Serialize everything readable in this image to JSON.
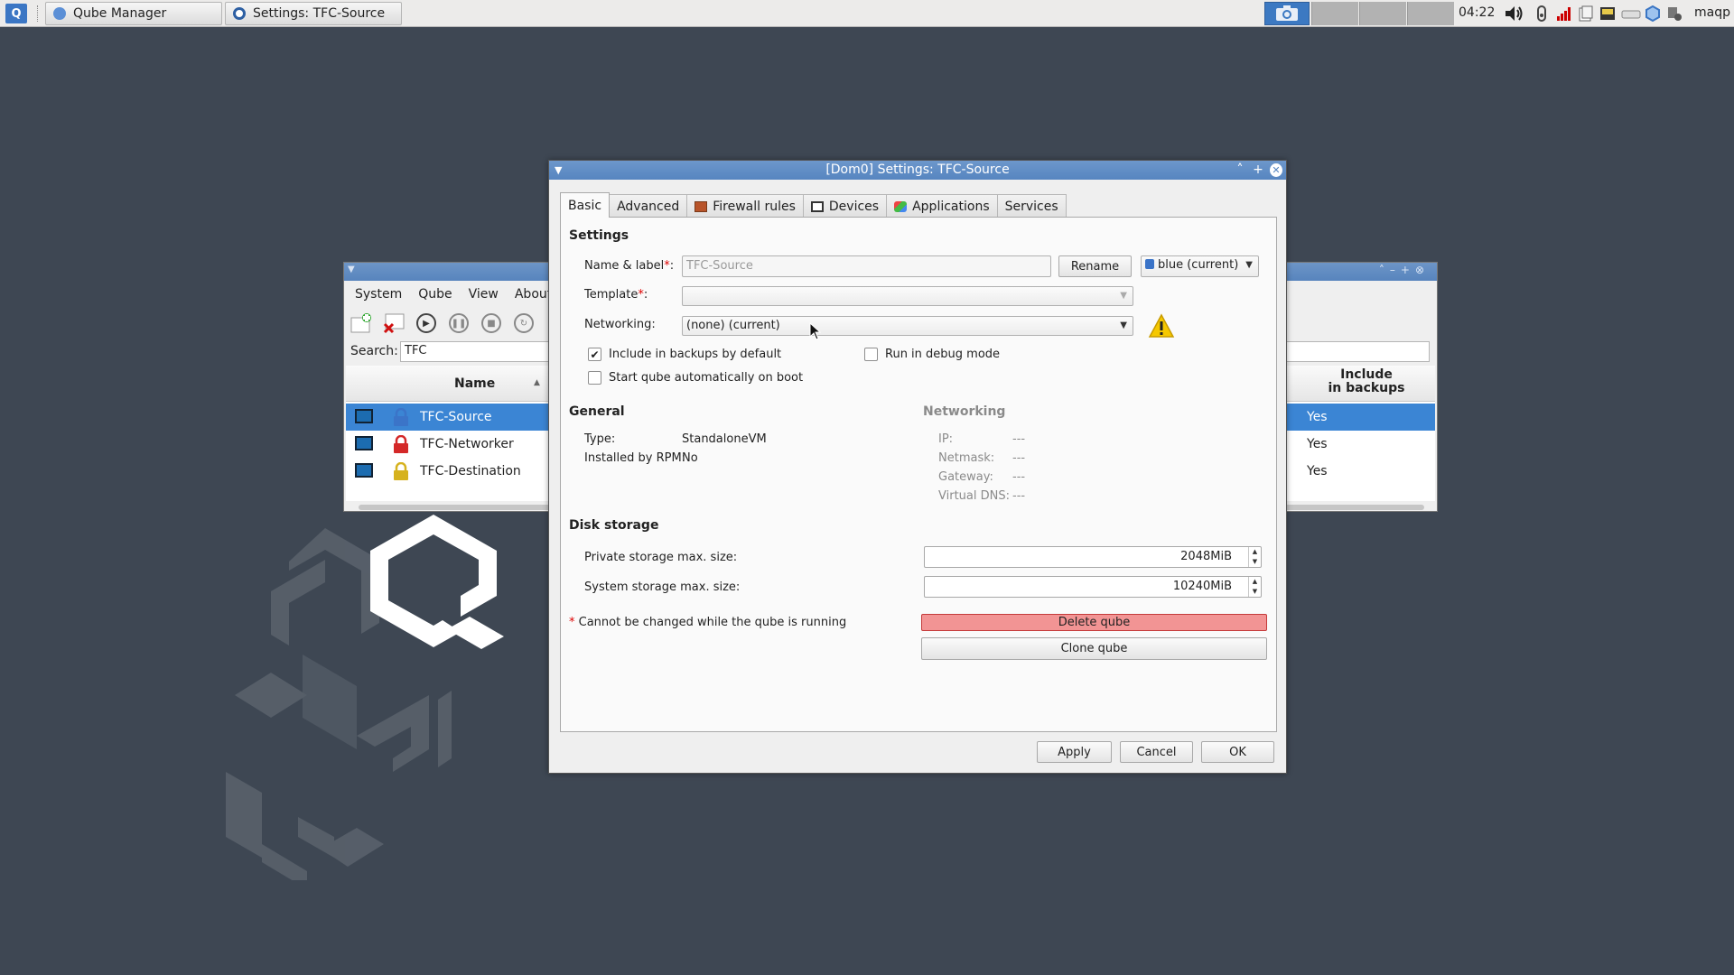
{
  "taskbar": {
    "tasks": [
      {
        "label": "Qube Manager",
        "icon": "qubes-icon"
      },
      {
        "label": "Settings: TFC-Source",
        "icon": "settings-gear-icon"
      }
    ],
    "clock": "04:22",
    "user": "maqp",
    "tray_icons": [
      "screenshot-icon",
      "volume-icon",
      "power-icon",
      "network-signal-icon",
      "clipboard-icon",
      "devices-icon",
      "drive-icon",
      "qubes-domains-icon",
      "updates-icon"
    ]
  },
  "qube_manager": {
    "menus": [
      "System",
      "Qube",
      "View",
      "About"
    ],
    "search_label": "Search:",
    "search_value": "TFC",
    "columns": {
      "name": "Name",
      "backups": "Include\nin backups"
    },
    "rows": [
      {
        "name": "TFC-Source",
        "backups": "Yes",
        "label_color": "#3b74c8",
        "selected": true
      },
      {
        "name": "TFC-Networker",
        "backups": "Yes",
        "label_color": "#d42828",
        "selected": false
      },
      {
        "name": "TFC-Destination",
        "backups": "Yes",
        "label_color": "#d6b21e",
        "selected": false
      }
    ]
  },
  "dialog": {
    "title": "[Dom0] Settings: TFC-Source",
    "tabs": [
      "Basic",
      "Advanced",
      "Firewall rules",
      "Devices",
      "Applications",
      "Services"
    ],
    "active_tab": "Basic",
    "settings": {
      "heading": "Settings",
      "name_label": "Name & label",
      "name_value": "TFC-Source",
      "rename_button": "Rename",
      "label_value": "blue (current)",
      "template_label": "Template",
      "template_value": "",
      "networking_label": "Networking:",
      "networking_value": "(none) (current)",
      "include_backups": "Include in backups by default",
      "include_backups_checked": true,
      "debug_mode": "Run in debug mode",
      "debug_mode_checked": false,
      "autostart": "Start qube automatically on boot",
      "autostart_checked": false
    },
    "general": {
      "heading": "General",
      "type_label": "Type:",
      "type_value": "StandaloneVM",
      "rpm_label": "Installed by RPM:",
      "rpm_value": "No"
    },
    "networking": {
      "heading": "Networking",
      "ip_label": "IP:",
      "ip_value": "---",
      "netmask_label": "Netmask:",
      "netmask_value": "---",
      "gateway_label": "Gateway:",
      "gateway_value": "---",
      "dns_label": "Virtual DNS:",
      "dns_value": "---"
    },
    "disk": {
      "heading": "Disk storage",
      "private_label": "Private storage max. size:",
      "private_value": "2048MiB",
      "system_label": "System storage max. size:",
      "system_value": "10240MiB"
    },
    "note": "Cannot be changed while the qube is running",
    "delete_button": "Delete qube",
    "clone_button": "Clone qube",
    "apply_button": "Apply",
    "cancel_button": "Cancel",
    "ok_button": "OK"
  },
  "colors": {
    "desktop": "#3e4753",
    "titlebar": "#5685c0",
    "selection": "#3b85d4",
    "delete": "#f29494"
  }
}
